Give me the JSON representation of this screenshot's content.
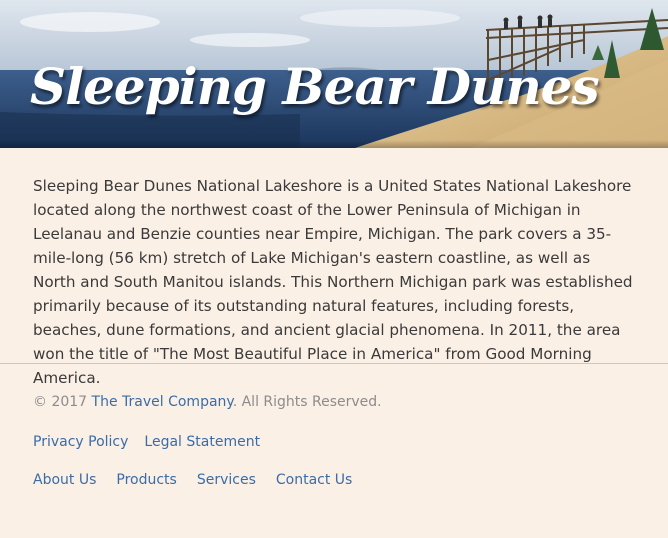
{
  "hero": {
    "title": "Sleeping Bear Dunes",
    "image_alt_subject": "dune overlook above Lake Michigan"
  },
  "intro": {
    "text": "Sleeping Bear Dunes National Lakeshore is a United States National Lakeshore located along the northwest coast of the Lower Peninsula of Michigan in Leelanau and Benzie counties near Empire, Michigan. The park covers a 35-mile-long (56 km) stretch of Lake Michigan's eastern coastline, as well as North and South Manitou islands. This Northern Michigan park was established primarily because of its outstanding natural features, including forests, beaches, dune formations, and ancient glacial phenomena. In 2011, the area won the title of \"The Most Beautiful Place in America\" from Good Morning America."
  },
  "footer": {
    "copyright_prefix": "© 2017 ",
    "company_link": "The Travel Company",
    "copyright_suffix": ". All Rights Reserved.",
    "legal_links": [
      "Privacy Policy",
      "Legal Statement"
    ],
    "nav_links": [
      "About Us",
      "Products",
      "Services",
      "Contact Us"
    ]
  },
  "colors": {
    "background": "#fbf0e6",
    "link": "#3a6ca8",
    "muted_text": "#8c8c8c",
    "body_text": "#3a3a3a",
    "lake": "#203f6a",
    "sand": "#dcc08e"
  }
}
